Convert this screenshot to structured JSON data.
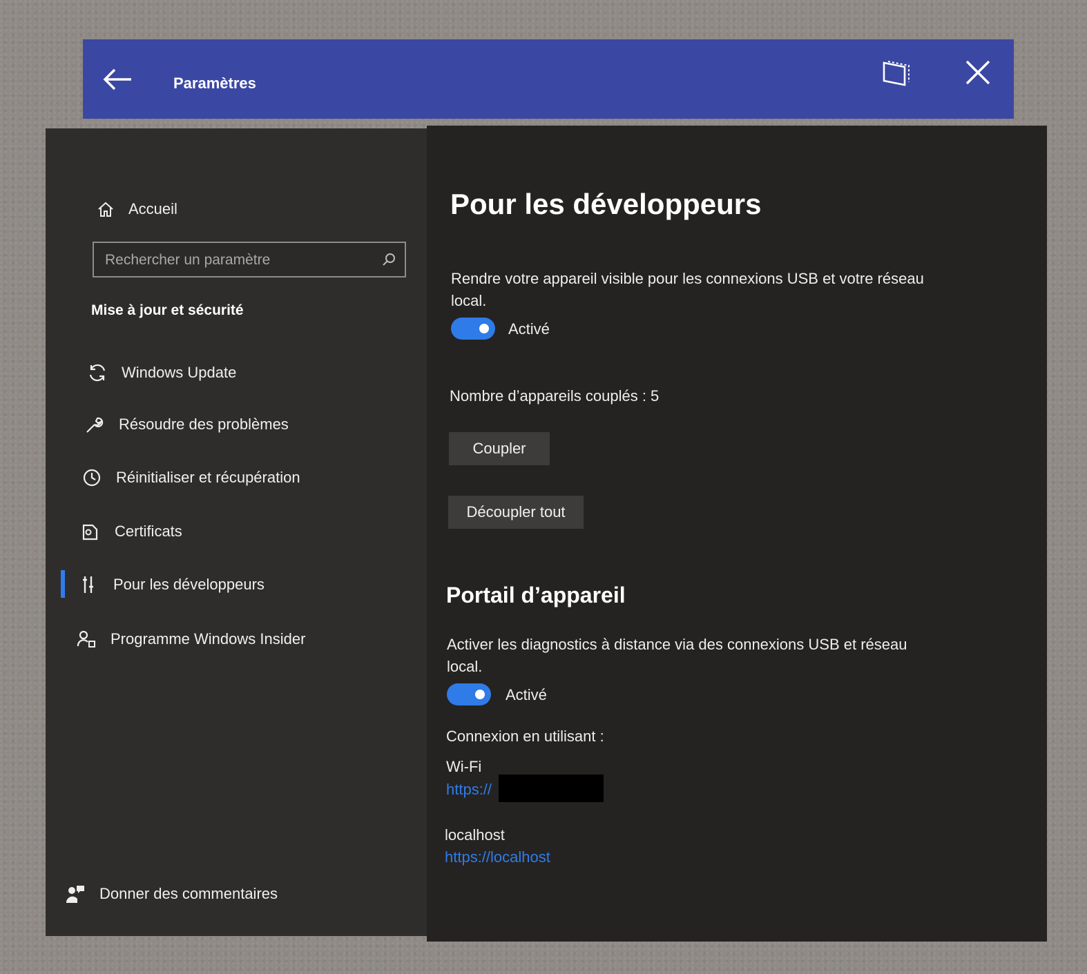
{
  "window": {
    "title": "Paramètres",
    "back_icon": "back-arrow-icon",
    "follow_icon": "follow-me-icon",
    "close_icon": "close-icon",
    "titlebar_color": "#3a47a3"
  },
  "sidebar": {
    "home_label": "Accueil",
    "search_placeholder": "Rechercher un paramètre",
    "section_title": "Mise à jour et sécurité",
    "items": [
      {
        "label": "Windows Update",
        "icon": "refresh-icon"
      },
      {
        "label": "Résoudre des problèmes",
        "icon": "wrench-icon"
      },
      {
        "label": "Réinitialiser et récupération",
        "icon": "history-icon"
      },
      {
        "label": "Certificats",
        "icon": "certificate-icon"
      },
      {
        "label": "Pour les développeurs",
        "icon": "developer-tools-icon",
        "selected": true
      },
      {
        "label": "Programme Windows Insider",
        "icon": "insider-icon"
      }
    ],
    "feedback_label": "Donner des commentaires",
    "accent_color": "#2f7cf0"
  },
  "main": {
    "title": "Pour les développeurs",
    "device_discovery": {
      "description": "Rendre votre appareil visible pour les connexions USB et votre réseau local.",
      "toggle_state": "Activé",
      "toggle_on": true
    },
    "paired_devices": "Nombre d’appareils couplés : 5",
    "pair_button": "Coupler",
    "unpair_all_button": "Découpler tout",
    "device_portal": {
      "title": "Portail d’appareil",
      "description": "Activer les diagnostics à distance via des connexions USB et réseau local.",
      "toggle_state": "Activé",
      "toggle_on": true,
      "connect_using": "Connexion en utilisant :",
      "wifi_label": "Wi-Fi",
      "wifi_url": "https://",
      "localhost_label": "localhost",
      "localhost_url": "https://localhost"
    },
    "link_color": "#2f7ce8"
  }
}
